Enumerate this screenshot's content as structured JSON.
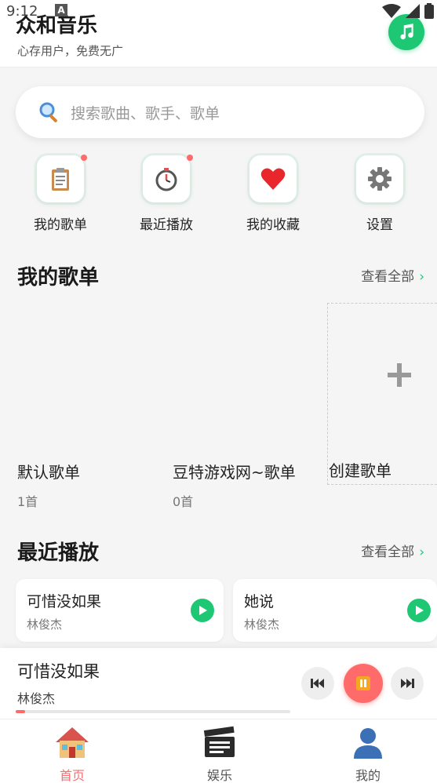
{
  "status": {
    "time": "9:12",
    "indicator": "A"
  },
  "header": {
    "title": "众和音乐",
    "subtitle": "心存用户，免费无广"
  },
  "search": {
    "placeholder": "搜索歌曲、歌手、歌单"
  },
  "quick_entries": [
    {
      "label": "我的歌单",
      "icon": "clipboard-icon",
      "dot": true
    },
    {
      "label": "最近播放",
      "icon": "stopwatch-icon",
      "dot": true
    },
    {
      "label": "我的收藏",
      "icon": "heart-icon",
      "dot": false
    },
    {
      "label": "设置",
      "icon": "gear-icon",
      "dot": false
    }
  ],
  "my_playlists": {
    "title": "我的歌单",
    "see_all": "查看全部",
    "arrow": "›",
    "items": [
      {
        "name": "默认歌单",
        "count": "1首"
      },
      {
        "name": "豆特游戏网~歌单",
        "count": "0首"
      }
    ],
    "create_label": "创建歌单"
  },
  "recent": {
    "title": "最近播放",
    "see_all": "查看全部",
    "arrow": "›",
    "items": [
      {
        "title": "可惜没如果",
        "artist": "林俊杰"
      },
      {
        "title": "她说",
        "artist": "林俊杰"
      }
    ]
  },
  "player": {
    "title": "可惜没如果",
    "artist": "林俊杰",
    "progress": 0.035
  },
  "tabs": [
    {
      "label": "首页",
      "icon": "house-icon",
      "active": true
    },
    {
      "label": "娱乐",
      "icon": "clapperboard-icon",
      "active": false
    },
    {
      "label": "我的",
      "icon": "person-icon",
      "active": false
    }
  ],
  "colors": {
    "accent": "#1ec773",
    "highlight": "#ff6b6b",
    "background": "#f5f5f5"
  }
}
